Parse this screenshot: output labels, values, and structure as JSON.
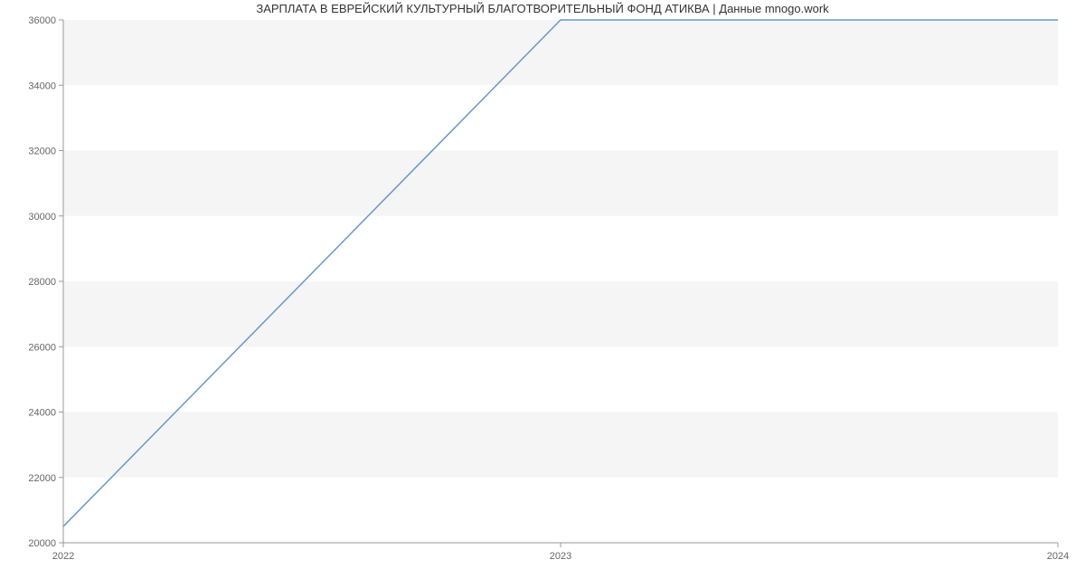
{
  "chart_data": {
    "type": "line",
    "title": "ЗАРПЛАТА В ЕВРЕЙСКИЙ КУЛЬТУРНЫЙ БЛАГОТВОРИТЕЛЬНЫЙ ФОНД АТИКВА | Данные mnogo.work",
    "x": [
      2022,
      2023,
      2024
    ],
    "values": [
      20500,
      36000,
      36000
    ],
    "xlabel": "",
    "ylabel": "",
    "xlim": [
      2022,
      2024
    ],
    "ylim": [
      20000,
      36000
    ],
    "x_ticks": [
      2022,
      2023,
      2024
    ],
    "y_ticks": [
      20000,
      22000,
      24000,
      26000,
      28000,
      30000,
      32000,
      34000,
      36000
    ],
    "line_color": "#6699cc",
    "band_color": "#f5f5f5"
  }
}
